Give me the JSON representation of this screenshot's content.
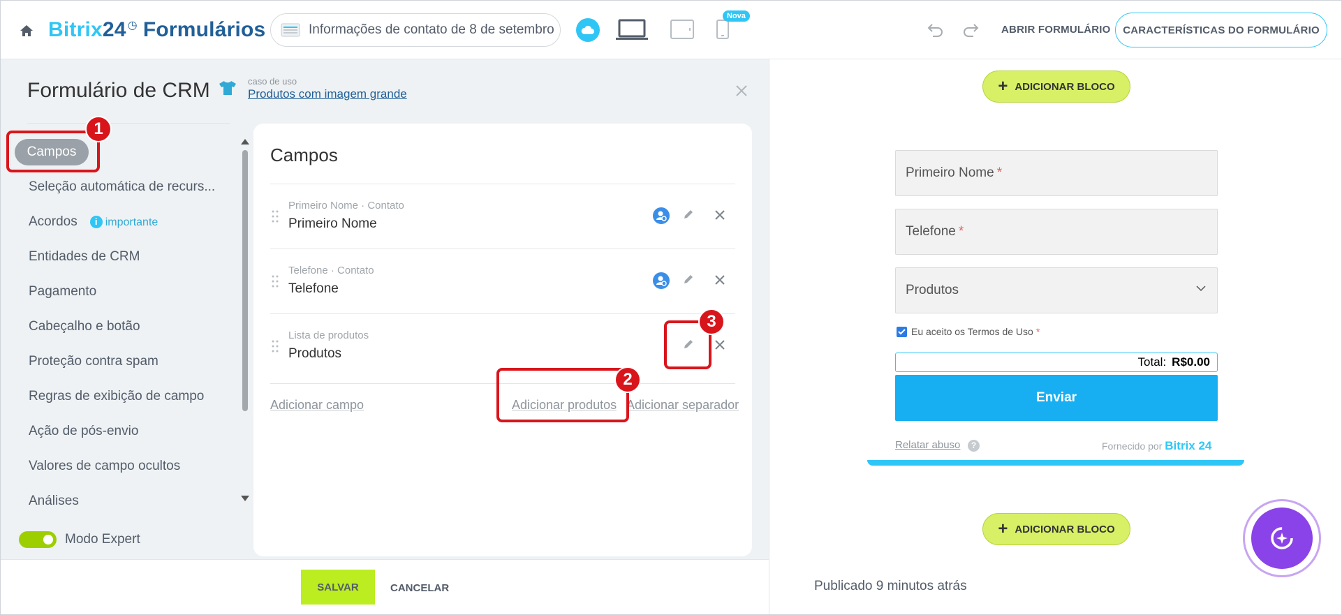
{
  "topbar": {
    "brand_a": "Bitrix",
    "brand_b": "24",
    "brand_clock": "◷",
    "brand_c": "Formulários",
    "form_name": "Informações de contato de 8 de setembro",
    "new_badge": "Nova",
    "open_form": "ABRIR FORMULÁRIO",
    "features": "CARACTERÍSTICAS DO FORMULÁRIO"
  },
  "panel": {
    "title": "Formulário de CRM",
    "case_label": "caso de uso",
    "case_link": "Produtos com imagem grande"
  },
  "nav": {
    "items": [
      "Campos",
      "Seleção automática de recurs...",
      "Acordos",
      "Entidades de CRM",
      "Pagamento",
      "Cabeçalho e botão",
      "Proteção contra spam",
      "Regras de exibição de campo",
      "Ação de pós-envio",
      "Valores de campo ocultos",
      "Análises"
    ],
    "important": "importante",
    "info_glyph": "i",
    "expert_mode": "Modo Expert"
  },
  "fields": {
    "title": "Campos",
    "rows": [
      {
        "sub": "Primeiro Nome · Contato",
        "name": "Primeiro Nome"
      },
      {
        "sub": "Telefone · Contato",
        "name": "Telefone"
      },
      {
        "sub": "Lista de produtos",
        "name": "Produtos"
      }
    ],
    "add_field": "Adicionar campo",
    "add_products": "Adicionar produtos",
    "add_separator": "Adicionar separador"
  },
  "footer": {
    "save": "SALVAR",
    "cancel": "CANCELAR"
  },
  "preview": {
    "add_block": "ADICIONAR BLOCO",
    "plus_glyph": "+",
    "first_name": "Primeiro Nome",
    "phone": "Telefone",
    "required_mark": "*",
    "products": "Produtos",
    "terms": "Eu aceito os Termos de Uso",
    "total_label": "Total:",
    "total_value": "R$0.00",
    "send": "Enviar",
    "report": "Relatar abuso",
    "question_glyph": "?",
    "powered_by": "Fornecido por",
    "powered_brand": "Bitrix 24",
    "published": "Publicado 9 minutos atrás"
  },
  "callouts": [
    "1",
    "2",
    "3"
  ],
  "colors": {
    "accent": "#2fc6f6",
    "brand_dark": "#215f98",
    "save_green": "#bbed21",
    "callout_red": "#d9151c",
    "send_blue": "#17aef2"
  }
}
